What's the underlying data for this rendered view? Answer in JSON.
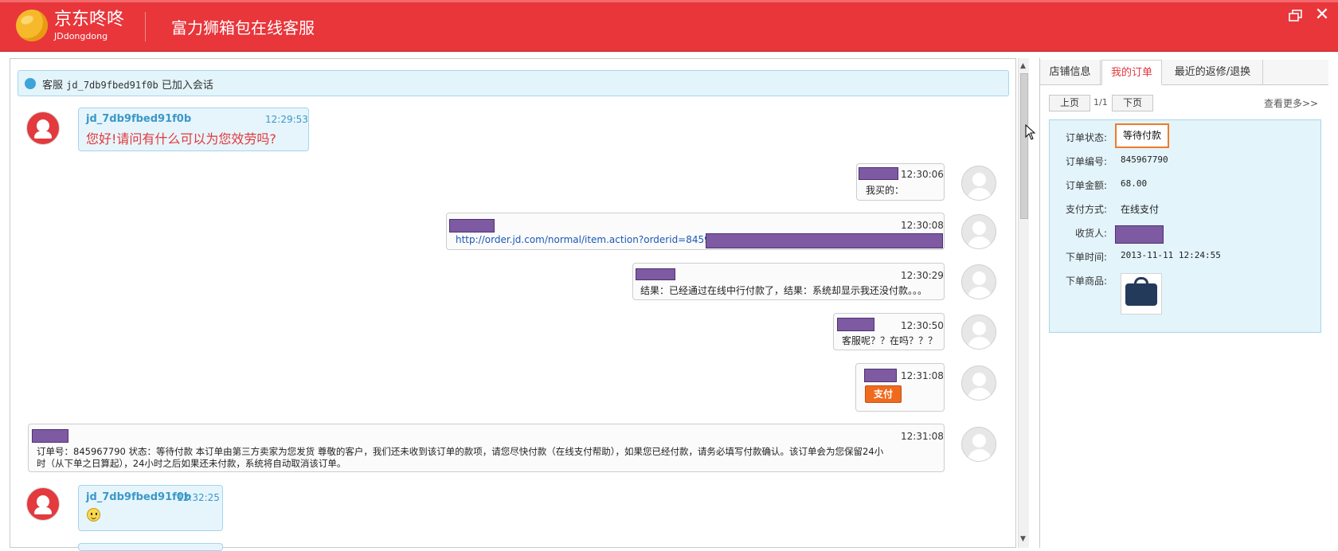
{
  "app": {
    "logo_name": "京东咚咚",
    "logo_sub": "JDdongdong",
    "window_title": "富力狮箱包在线客服"
  },
  "notice": {
    "prefix": "客服",
    "agent_id": "jd_7db9fbed91f0b",
    "suffix": "已加入会话"
  },
  "messages": [
    {
      "sender": "jd_7db9fbed91f0b",
      "time": "12:29:53",
      "text": "您好!请问有什么可以为您效劳吗?"
    },
    {
      "time": "12:30:06",
      "text": "我买的："
    },
    {
      "time": "12:30:08",
      "text": "http://order.jd.com/normal/item.action?orderid=8459677908"
    },
    {
      "time": "12:30:29",
      "text": "结果：已经通过在线中行付款了，结果：系统却显示我还没付款。。。"
    },
    {
      "time": "12:30:50",
      "text": "客服呢？？在吗？？？"
    },
    {
      "time": "12:31:08",
      "button": "支付"
    },
    {
      "time": "12:31:08",
      "text_line1": "订单号：845967790   状态：等待付款    本订单由第三方卖家为您发货 尊敬的客户，我们还未收到该订单的款项，请您尽快付款（在线支付帮助），如果您已经付款，请务必填写付款确认。该订单会为您保留24小",
      "text_line2": "时（从下单之日算起），24小时之后如果还未付款，系统将自动取消该订单。"
    },
    {
      "sender": "jd_7db9fbed91f0b",
      "time": "12:32:25",
      "emoji": "smile"
    }
  ],
  "sidebar": {
    "tabs": [
      "店铺信息",
      "我的订单",
      "最近的返修/退换"
    ],
    "active_tab": "我的订单",
    "pager": {
      "prev": "上页",
      "page": "1/1",
      "next": "下页",
      "more": "查看更多>>"
    },
    "order": {
      "status_label": "订单状态:",
      "status_value": "等待付款",
      "number_label": "订单编号:",
      "number_value": "845967790",
      "amount_label": "订单金额:",
      "amount_value": "68.00",
      "payment_label": "支付方式:",
      "payment_value": "在线支付",
      "receiver_label": "收货人:",
      "time_label": "下单时间:",
      "time_value": "2013-11-11 12:24:55",
      "product_label": "下单商品:"
    }
  },
  "colors": {
    "titlebar": "#e8363b",
    "redaction": "#7e5aa2",
    "link": "#1b57b8",
    "cs_name": "#3b98c8",
    "status_border": "#f07a28"
  }
}
